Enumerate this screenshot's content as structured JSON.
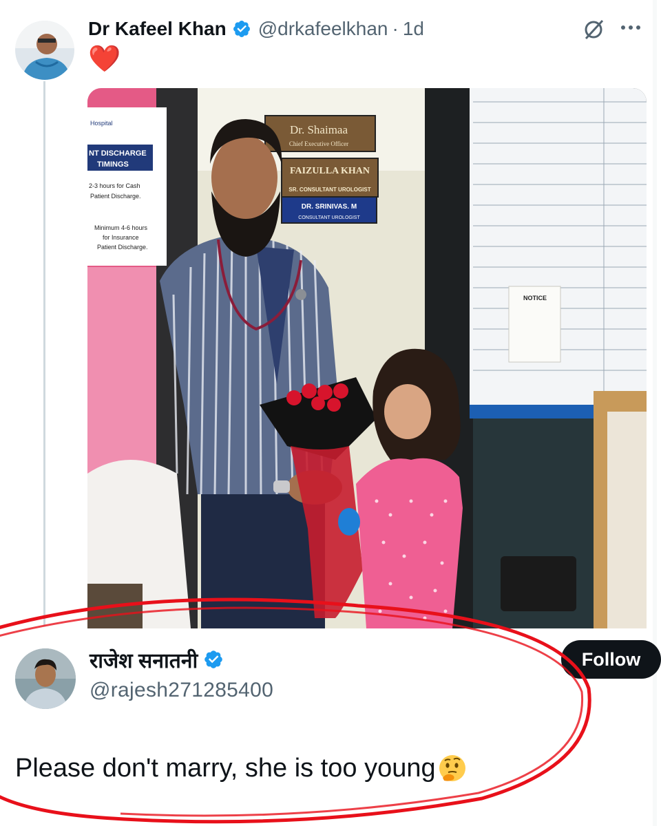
{
  "tweet1": {
    "author_name": "Dr Kafeel Khan",
    "handle": "@drkafeelkhan",
    "separator": "·",
    "age": "1d",
    "body_emoji": "❤️",
    "icons": [
      "verified-badge",
      "grok-icon",
      "more-options-icon"
    ]
  },
  "photo": {
    "signs": {
      "door_sign_1": "Dr. Shaimaa",
      "door_sign_1_sub": "Chief Executive Officer",
      "door_sign_2": "FAIZULLA KHAN",
      "door_sign_2_sub": "SR. CONSULTANT UROLOGIST",
      "door_sign_3": "DR. SRINIVAS. M",
      "door_sign_3_sub": "CONSULTANT UROLOGIST",
      "poster_hospital": "Hospital",
      "poster_title_1": "NT DISCHARGE",
      "poster_title_2": "TIMINGS",
      "poster_line_1": "2-3 hours for Cash",
      "poster_line_2": "Patient Discharge.",
      "poster_line_3": "Minimum 4-6 hours",
      "poster_line_4": "for Insurance",
      "poster_line_5": "Patient Discharge.",
      "notice_title": "NOTICE"
    }
  },
  "tweet2": {
    "author_name": "राजेश सनातनी",
    "handle": "@rajesh271285400",
    "follow_label": "Follow",
    "text": "Please don't marry, she is too young",
    "emoji": "thinking-face"
  },
  "colors": {
    "verified_blue": "#1d9bf0",
    "annotation_red": "#e8101a",
    "follow_bg": "#0f1419",
    "muted_text": "#536471"
  }
}
